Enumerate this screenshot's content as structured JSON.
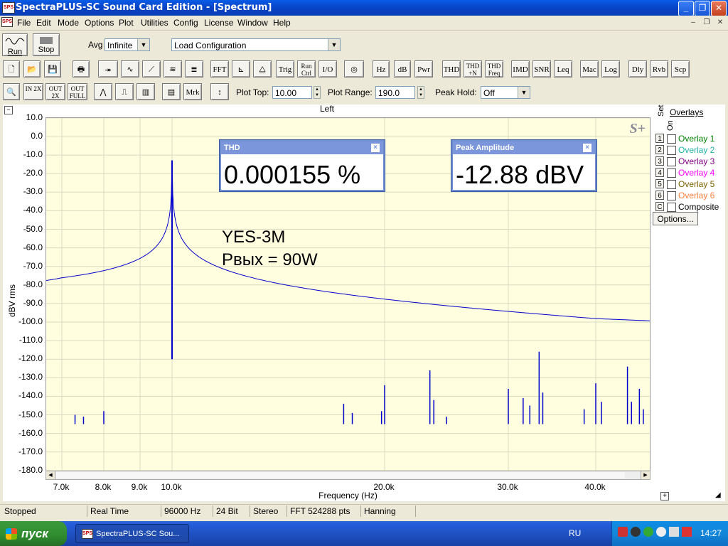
{
  "window": {
    "title": "SpectraPLUS-SC Sound Card Edition - [Spectrum]",
    "app_icon_text": "SPS"
  },
  "menu": [
    "File",
    "Edit",
    "Mode",
    "Options",
    "Plot",
    "Utilities",
    "Config",
    "License",
    "Window",
    "Help"
  ],
  "toolbar1": {
    "run_label": "Run",
    "stop_label": "Stop",
    "avg_label": "Avg",
    "avg_value": "Infinite",
    "config_value": "Load Configuration"
  },
  "toolbar2": [
    "FFT",
    "Trig",
    "Run Ctrl",
    "I/O",
    "Hz",
    "dB",
    "Pwr",
    "THD",
    "THD +N",
    "THD Freq",
    "IMD",
    "SNR",
    "Leq",
    "Mac",
    "Log",
    "Dly",
    "Rvb",
    "Scp"
  ],
  "toolbar3": {
    "zoom_buttons": [
      "IN 2X",
      "OUT 2X",
      "OUT FULL"
    ],
    "mrk_label": "Mrk",
    "plot_top_label": "Plot Top:",
    "plot_top_value": "10.00",
    "plot_range_label": "Plot Range:",
    "plot_range_value": "190.0",
    "peak_hold_label": "Peak Hold:",
    "peak_hold_value": "Off"
  },
  "plot": {
    "channel_label": "Left",
    "logo": "S+",
    "annotation_line1": "YES-3M",
    "annotation_line2": "Рвых = 90W",
    "collapse_icon": "−",
    "expand_icon": "+"
  },
  "chart_data": {
    "type": "line",
    "title": "Left",
    "xlabel": "Frequency (Hz)",
    "ylabel": "dBV rms",
    "xlim": [
      6500,
      44000
    ],
    "ylim": [
      -180,
      10
    ],
    "yticks": [
      "10.0",
      "0.0",
      "-10.0",
      "-20.0",
      "-30.0",
      "-40.0",
      "-50.0",
      "-60.0",
      "-70.0",
      "-80.0",
      "-90.0",
      "-100.0",
      "-110.0",
      "-120.0",
      "-130.0",
      "-140.0",
      "-150.0",
      "-160.0",
      "-170.0",
      "-180.0"
    ],
    "xticks": [
      {
        "v": 7000,
        "label": "7.0k"
      },
      {
        "v": 8000,
        "label": "8.0k"
      },
      {
        "v": 9000,
        "label": "9.0k"
      },
      {
        "v": 10000,
        "label": "10.0k"
      },
      {
        "v": 20000,
        "label": "20.0k"
      },
      {
        "v": 30000,
        "label": "30.0k"
      },
      {
        "v": 40000,
        "label": "40.0k"
      }
    ],
    "noise_floor": -154,
    "fundamental": {
      "x": 10000,
      "y": -12.88
    },
    "peaks": [
      {
        "x": 7300,
        "y": -150
      },
      {
        "x": 7500,
        "y": -151
      },
      {
        "x": 8000,
        "y": -148
      },
      {
        "x": 17500,
        "y": -144
      },
      {
        "x": 18000,
        "y": -149
      },
      {
        "x": 20000,
        "y": -134
      },
      {
        "x": 19800,
        "y": -148
      },
      {
        "x": 23200,
        "y": -126
      },
      {
        "x": 23500,
        "y": -142
      },
      {
        "x": 24500,
        "y": -151
      },
      {
        "x": 30000,
        "y": -136
      },
      {
        "x": 31500,
        "y": -141
      },
      {
        "x": 32200,
        "y": -145
      },
      {
        "x": 33200,
        "y": -116
      },
      {
        "x": 33600,
        "y": -138
      },
      {
        "x": 38500,
        "y": -147
      },
      {
        "x": 40000,
        "y": -133
      },
      {
        "x": 40400,
        "y": -143
      },
      {
        "x": 42300,
        "y": -124
      },
      {
        "x": 42600,
        "y": -143
      },
      {
        "x": 43200,
        "y": -136
      },
      {
        "x": 43500,
        "y": -147
      }
    ],
    "series_color": "#0000cc",
    "grid": true
  },
  "meters": {
    "thd": {
      "title": "THD",
      "value": "0.000155 %"
    },
    "peak": {
      "title": "Peak Amplitude",
      "value": "-12.88 dBV"
    }
  },
  "overlays": {
    "title": "Overlays",
    "set_label": "Set",
    "on_label": "On",
    "items": [
      {
        "num": "1",
        "label": "Overlay 1",
        "color": "#008000"
      },
      {
        "num": "2",
        "label": "Overlay 2",
        "color": "#20b2aa"
      },
      {
        "num": "3",
        "label": "Overlay 3",
        "color": "#800080"
      },
      {
        "num": "4",
        "label": "Overlay 4",
        "color": "#ff00ff"
      },
      {
        "num": "5",
        "label": "Overlay 5",
        "color": "#806000"
      },
      {
        "num": "6",
        "label": "Overlay 6",
        "color": "#ff8040"
      },
      {
        "num": "C",
        "label": "Composite",
        "color": "#000000"
      }
    ],
    "options_label": "Options..."
  },
  "status": [
    "Stopped",
    "Real Time",
    "96000 Hz",
    "24 Bit",
    "Stereo",
    "FFT 524288 pts",
    "Hanning"
  ],
  "taskbar": {
    "start": "пуск",
    "app": "SpectraPLUS-SC Sou...",
    "lang": "RU",
    "clock": "14:27"
  }
}
